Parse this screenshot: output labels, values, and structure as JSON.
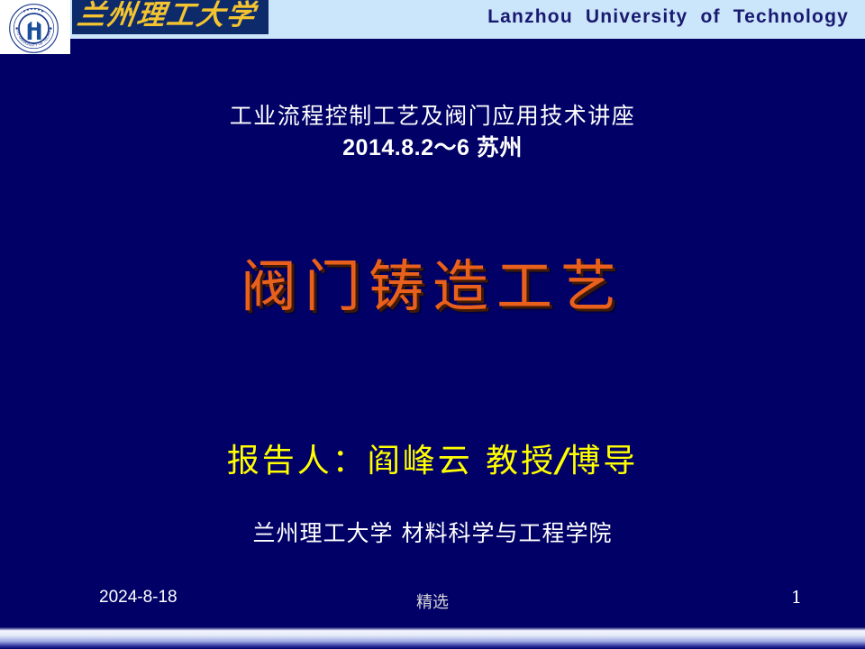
{
  "header": {
    "title_en": "Lanzhou   University   of   Technology",
    "wordmark_cn": "兰州理工大学",
    "emblem_top_text": "兰州理工大学",
    "emblem_ring_text": "LANZHOU UNIVERSITY OF TECHNOLOGY"
  },
  "subtitle": {
    "line1": "工业流程控制工艺及阀门应用技术讲座",
    "line2": "2014.8.2～6  苏州"
  },
  "title": {
    "main": "阀门铸造工艺"
  },
  "presenter": {
    "prefix": "报告人：阎峰云   教授",
    "separator": "/",
    "suffix": "博导"
  },
  "affiliation": {
    "text": "兰州理工大学 材料科学与工程学院"
  },
  "footer": {
    "date": "2024-8-18",
    "center_label": "精选",
    "page_number": "1"
  },
  "colors": {
    "background": "#000066",
    "banner": "#cbe6fb",
    "banner_text": "#191970",
    "title_orange": "#e8601c",
    "presenter_yellow": "#ffff00",
    "wordmark_gold": "#f4c430",
    "body_white": "#ffffff"
  }
}
